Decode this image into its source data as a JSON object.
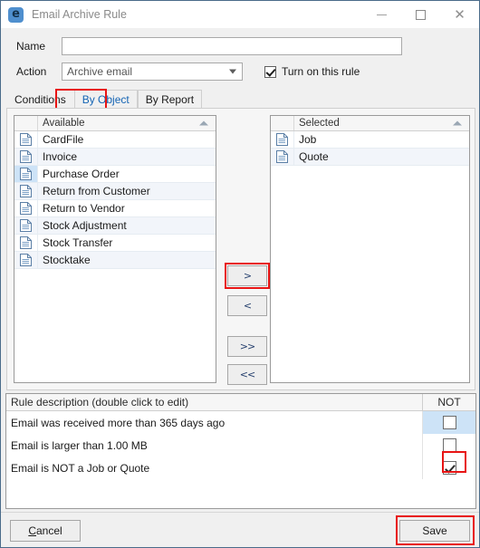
{
  "window": {
    "title": "Email Archive Rule",
    "app_icon": "email-archive-icon",
    "controls": {
      "minimize": "minimize-icon",
      "maximize": "maximize-icon",
      "close": "close-icon"
    }
  },
  "form": {
    "name_label": "Name",
    "name_value": "",
    "name_placeholder": "",
    "action_label": "Action",
    "action_value": "Archive email",
    "action_options": [
      "Archive email"
    ],
    "turn_on_label": "Turn on this rule",
    "turn_on_checked": true
  },
  "tabs": [
    {
      "label": "Conditions",
      "active": false
    },
    {
      "label": "By Object",
      "active": true
    },
    {
      "label": "By Report",
      "active": false
    }
  ],
  "available": {
    "header": "Available",
    "sort": "ascending",
    "items": [
      {
        "label": "CardFile",
        "selected": false
      },
      {
        "label": "Invoice",
        "selected": false
      },
      {
        "label": "Purchase Order",
        "selected": true
      },
      {
        "label": "Return from Customer",
        "selected": false
      },
      {
        "label": "Return to Vendor",
        "selected": false
      },
      {
        "label": "Stock Adjustment",
        "selected": false
      },
      {
        "label": "Stock Transfer",
        "selected": false
      },
      {
        "label": "Stocktake",
        "selected": false
      }
    ]
  },
  "selected": {
    "header": "Selected",
    "sort": "ascending",
    "items": [
      {
        "label": "Job",
        "selected": false
      },
      {
        "label": "Quote",
        "selected": false
      }
    ]
  },
  "transfer_buttons": {
    "add": ">",
    "remove": "<",
    "add_all": ">>",
    "remove_all": "<<"
  },
  "rule_grid": {
    "header_description": "Rule description (double click to edit)",
    "header_not": "NOT",
    "rows": [
      {
        "description": "Email was received more than 365 days ago",
        "not_checked": false,
        "not_cell_highlighted": true
      },
      {
        "description": "Email is larger than 1.00 MB",
        "not_checked": false,
        "not_cell_highlighted": false
      },
      {
        "description": "Email is NOT a Job or Quote",
        "not_checked": true,
        "not_cell_highlighted": false
      }
    ]
  },
  "footer": {
    "cancel_label": "Cancel",
    "cancel_accel": "C",
    "save_label": "Save"
  },
  "colors": {
    "annotation": "#e81414",
    "active_tab_text": "#1464b4",
    "selection": "#cde3f7",
    "row_alt": "#f2f5fa",
    "title_bar": "#ffffff",
    "window_border": "#4a6b8a"
  }
}
